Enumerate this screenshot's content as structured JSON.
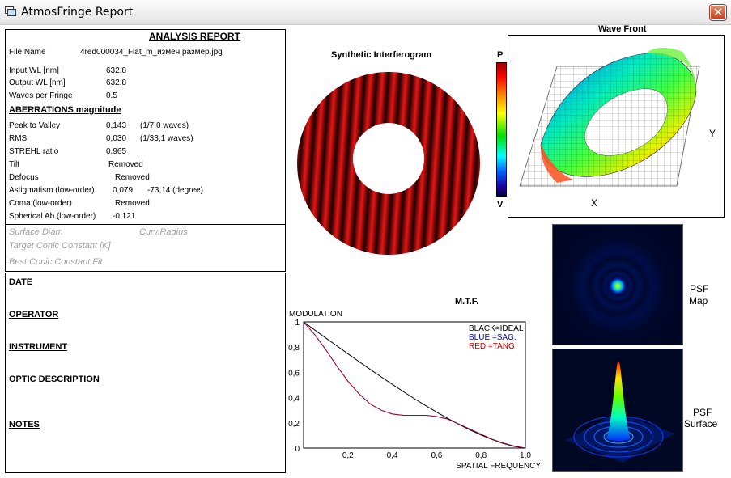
{
  "window": {
    "title": "AtmosFringe  Report",
    "close_symbol": "✕"
  },
  "report": {
    "heading": "ANALYSIS  REPORT",
    "file_label": "File Name",
    "file_value": "4red000034_Flat_m_измен.размер.jpg",
    "input_wl_label": "Input  WL [nm]",
    "input_wl_value": "632.8",
    "output_wl_label": "Output WL [nm]",
    "output_wl_value": "632.8",
    "waves_label": "Waves per Fringe",
    "waves_value": "0.5",
    "aberr_heading": "ABERRATIONS magnitude",
    "ptv_label": "Peak to Valley",
    "ptv_value": "0,143",
    "ptv_waves": "(1/7,0 waves)",
    "rms_label": "RMS",
    "rms_value": "0,030",
    "rms_waves": "(1/33,1 waves)",
    "strehl_label": "STREHL ratio",
    "strehl_value": "0,965",
    "tilt_label": "Tilt",
    "tilt_value": "Removed",
    "defocus_label": "Defocus",
    "defocus_value": "Removed",
    "astig_label": "Astigmatism  (low-order)",
    "astig_value": "0,079",
    "astig_angle": "-73,14  (degree)",
    "coma_label": "Coma          (low-order)",
    "coma_value": "Removed",
    "spher_label": "Spherical Ab.(low-order)",
    "spher_value": "-0,121",
    "surface_diam": "Surface Diam",
    "curv_radius": "Curv.Radius",
    "target_conic": "Target Conic Constant [K]",
    "best_conic": "Best Conic Constant Fit"
  },
  "info": {
    "date": "DATE",
    "operator": "OPERATOR",
    "instrument": "INSTRUMENT",
    "optic": "OPTIC DESCRIPTION",
    "notes": "NOTES"
  },
  "interferogram": {
    "title": "Synthetic Interferogram",
    "scale_top": "P",
    "scale_bottom": "V"
  },
  "wavefront": {
    "title": "Wave Front",
    "x_label": "X",
    "y_label": "Y"
  },
  "psf": {
    "map_label_1": "PSF",
    "map_label_2": "Map",
    "surface_label_1": "PSF",
    "surface_label_2": "Surface"
  },
  "colors": {
    "fringe": "#d01010",
    "close": "#c3401e",
    "ideal": "#000000",
    "sag": "#0000c0",
    "tang": "#c00000"
  },
  "chart_data": {
    "type": "line",
    "title": "M.T.F.",
    "ylabel": "MODULATION",
    "xlabel": "SPATIAL FREQUENCY",
    "xlim": [
      0,
      1
    ],
    "ylim": [
      0,
      1
    ],
    "x_ticks": [
      "0,2",
      "0,4",
      "0,6",
      "0,8",
      "1,0"
    ],
    "y_ticks": [
      "0",
      "0,2",
      "0,4",
      "0,6",
      "0,8",
      "1"
    ],
    "legend": [
      {
        "text": "BLACK=IDEAL",
        "color": "#000000"
      },
      {
        "text": "BLUE  =SAG.",
        "color": "#0000c0"
      },
      {
        "text": "RED    =TANG",
        "color": "#c00000"
      }
    ],
    "x": [
      0,
      0.05,
      0.1,
      0.15,
      0.2,
      0.25,
      0.3,
      0.35,
      0.4,
      0.45,
      0.5,
      0.55,
      0.6,
      0.65,
      0.7,
      0.75,
      0.8,
      0.85,
      0.9,
      0.95,
      1.0
    ],
    "series": [
      {
        "name": "IDEAL",
        "color": "#000000",
        "values": [
          1.0,
          0.936,
          0.873,
          0.81,
          0.747,
          0.685,
          0.624,
          0.564,
          0.505,
          0.447,
          0.391,
          0.337,
          0.285,
          0.235,
          0.188,
          0.144,
          0.104,
          0.068,
          0.037,
          0.013,
          0.0
        ]
      },
      {
        "name": "SAG.",
        "color": "#0000c0",
        "values": [
          1.0,
          0.9,
          0.78,
          0.65,
          0.53,
          0.43,
          0.35,
          0.3,
          0.27,
          0.26,
          0.26,
          0.26,
          0.25,
          0.23,
          0.19,
          0.15,
          0.11,
          0.07,
          0.04,
          0.015,
          0.0
        ]
      },
      {
        "name": "TANG",
        "color": "#c00000",
        "values": [
          1.0,
          0.9,
          0.78,
          0.65,
          0.53,
          0.43,
          0.35,
          0.3,
          0.27,
          0.26,
          0.26,
          0.26,
          0.25,
          0.23,
          0.19,
          0.15,
          0.11,
          0.07,
          0.04,
          0.015,
          0.0
        ]
      }
    ]
  }
}
